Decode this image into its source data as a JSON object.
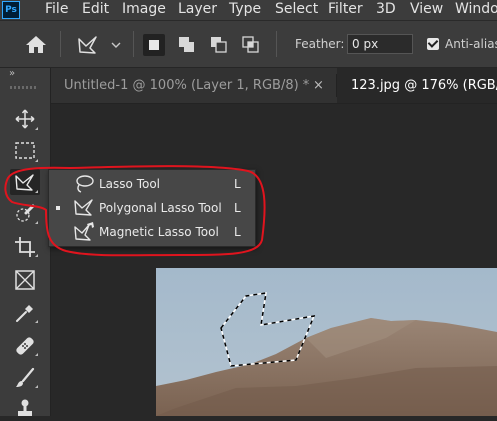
{
  "menubar": {
    "app_logo": "Ps",
    "items": [
      "File",
      "Edit",
      "Image",
      "Layer",
      "Type",
      "Select",
      "Filter",
      "3D",
      "View",
      "Windo"
    ]
  },
  "options": {
    "feather_label": "Feather:",
    "feather_value": "0 px",
    "anti_alias_label": "Anti-alias",
    "anti_alias_checked": true
  },
  "tabs": [
    {
      "title": "Untitled-1 @ 100% (Layer 1, RGB/8) *",
      "close": "×",
      "active": false
    },
    {
      "title": "123.jpg @ 176% (RGB/",
      "active": true
    }
  ],
  "toolbar": {
    "collapse_label": "»",
    "tools": [
      "move-tool",
      "marquee-tool",
      "lasso-tool",
      "quick-selection-tool",
      "crop-tool",
      "frame-tool",
      "eyedropper-tool",
      "healing-brush-tool",
      "brush-tool",
      "clone-stamp-tool"
    ]
  },
  "flyout": {
    "items": [
      {
        "label": "Lasso Tool",
        "key": "L",
        "icon": "lasso-icon",
        "selected": false
      },
      {
        "label": "Polygonal Lasso Tool",
        "key": "L",
        "icon": "polygonal-lasso-icon",
        "selected": true
      },
      {
        "label": "Magnetic Lasso Tool",
        "key": "L",
        "icon": "magnetic-lasso-icon",
        "selected": false
      }
    ]
  },
  "colors": {
    "annotation": "#e0141e",
    "sky": "#a9bdcd",
    "hill": "#8a7462"
  }
}
